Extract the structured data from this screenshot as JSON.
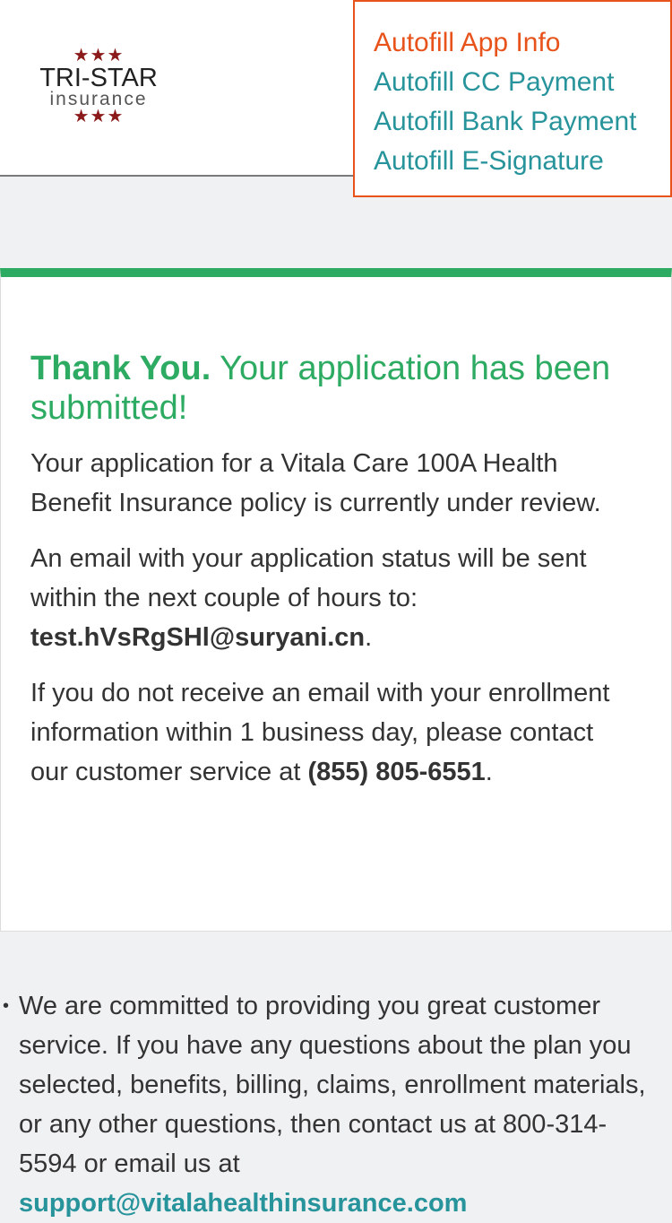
{
  "logo": {
    "stars_top": "★★★",
    "brand": "TRI-STAR",
    "sub": "insurance",
    "stars_bottom": "★★★"
  },
  "autofill": {
    "items": [
      {
        "label": "Autofill App Info",
        "active": true
      },
      {
        "label": "Autofill CC Payment",
        "active": false
      },
      {
        "label": "Autofill Bank Payment",
        "active": false
      },
      {
        "label": "Autofill E-Signature",
        "active": false
      }
    ]
  },
  "confirmation": {
    "title_bold": "Thank You.",
    "title_rest": " Your application has been submitted!",
    "para1": "Your application for a Vitala Care 100A Health Benefit Insurance policy is currently under review.",
    "para2_prefix": "An email with your application status will be sent within the next couple of hours to: ",
    "email": "test.hVsRgSHl@suryani.cn",
    "para2_suffix": ".",
    "para3_prefix": "If you do not receive an email with your enrollment information within 1 business day, please contact our customer service at ",
    "phone": "(855) 805-6551",
    "para3_suffix": "."
  },
  "info": {
    "bullet": "•",
    "text": "We are committed to providing you great customer service. If you have any questions about the plan you selected, benefits, billing, claims, enrollment materials, or any other questions, then contact us at 800-314-5594 or email us at ",
    "link": "support@vitalahealthinsurance.com"
  },
  "colors": {
    "accent_green": "#2eab62",
    "link_teal": "#27939b",
    "autofill_orange": "#e8531c",
    "logo_star": "#8b1a1a"
  }
}
